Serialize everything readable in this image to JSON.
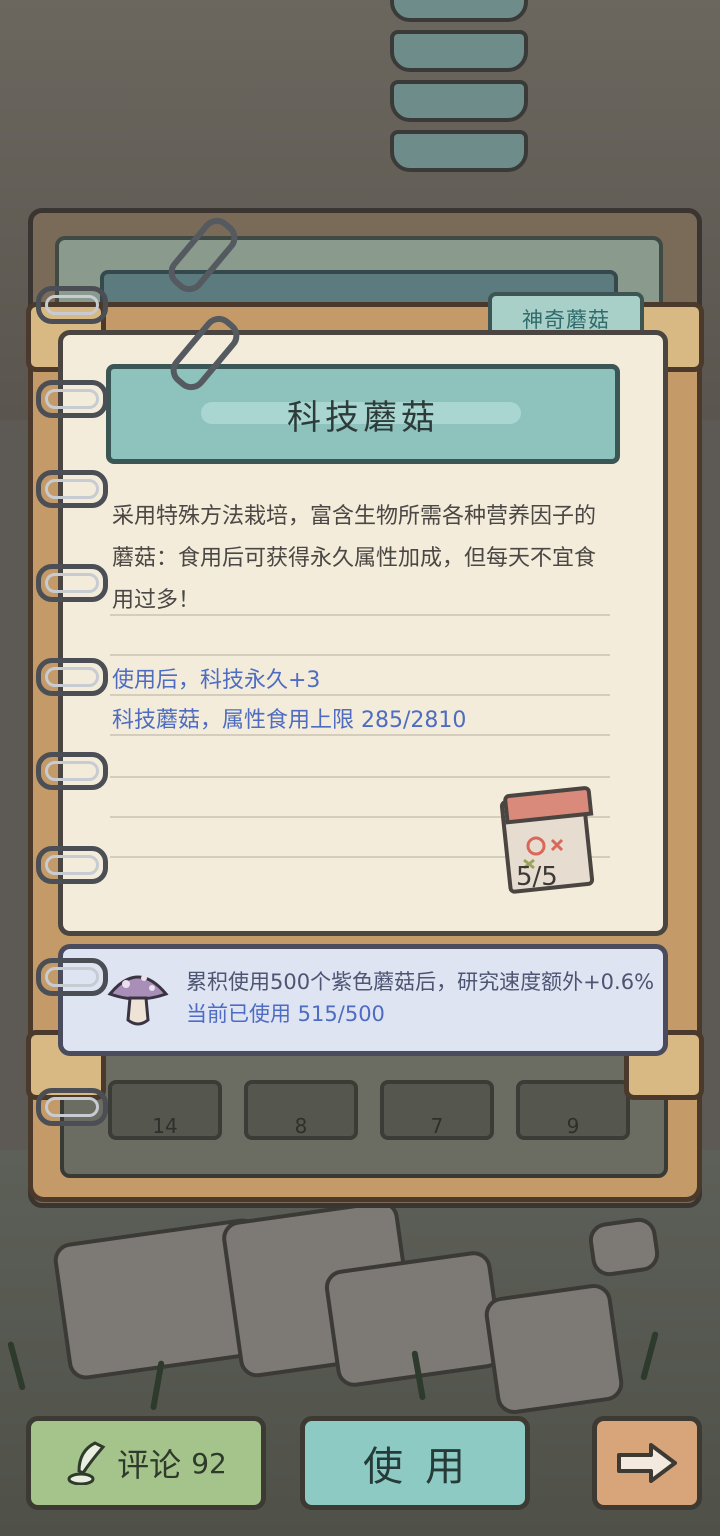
{
  "category_tab": "神奇蘑菇",
  "item": {
    "title": "科技蘑菇",
    "description": "采用特殊方法栽培，富含生物所需各种营养因子的蘑菇：食用后可获得永久属性加成，但每天不宜食用过多！",
    "effect_1": "使用后，科技永久+3",
    "effect_2": "科技蘑菇，属性食用上限  285/2810",
    "page_indicator": "5/5"
  },
  "bonus": {
    "line1": "累积使用500个紫色蘑菇后，研究速度额外+0.6%",
    "line2": "当前已使用  515/500",
    "icon": "purple-mushroom-icon"
  },
  "slots": [
    "14",
    "8",
    "7",
    "9"
  ],
  "buttons": {
    "comment_label": "评论",
    "comment_count": "92",
    "use_label": "使用",
    "next_icon": "arrow-right-icon"
  },
  "colors": {
    "accent_text": "#4e6cc2",
    "title_banner": "#8ec3bd",
    "page_bg": "#f3ecda"
  }
}
